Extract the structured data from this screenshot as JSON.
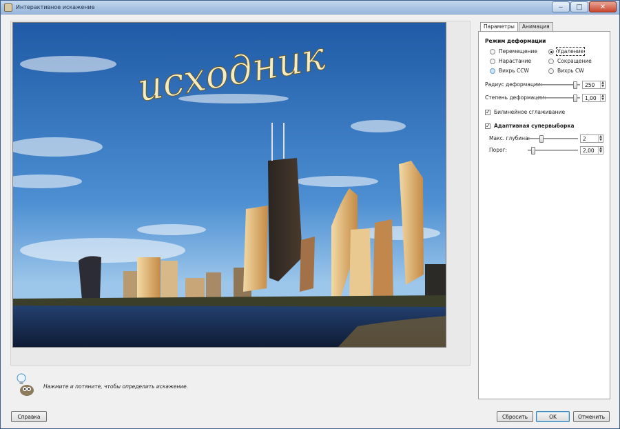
{
  "window": {
    "title": "Интерактивное искажение",
    "controls": {
      "minimize": "‒",
      "maximize": "□",
      "close": "✕"
    }
  },
  "preview": {
    "overlay_text": "исходник",
    "sky_color": "#3e74b8",
    "water_color": "#1c2f52"
  },
  "hint": {
    "text": "Нажмите и потяните, чтобы определить искажение."
  },
  "tabs": [
    {
      "label": "Параметры",
      "active": true
    },
    {
      "label": "Анимация",
      "active": false
    }
  ],
  "deform_mode": {
    "title": "Режим деформации",
    "options": {
      "move": "Перемещение",
      "remove": "Удаление",
      "grow": "Нарастание",
      "shrink": "Сокращение",
      "swirl_ccw": "Вихрь CCW",
      "swirl_cw": "Вихрь CW"
    },
    "selected": "Удаление"
  },
  "sliders": {
    "radius": {
      "label": "Радиус деформации:",
      "value": "250",
      "fraction": 0.93
    },
    "amount": {
      "label": "Степень деформации:",
      "value": "1,00",
      "fraction": 0.93
    }
  },
  "bilinear": {
    "label": "Билинейное сглаживание",
    "checked": true
  },
  "supersample": {
    "label": "Адаптивная супервыборка",
    "checked": true,
    "max_depth": {
      "label": "Макс. глубина:",
      "value": "2",
      "fraction": 0.25
    },
    "threshold": {
      "label": "Порог:",
      "value": "2,00",
      "fraction": 0.07
    }
  },
  "buttons": {
    "help": "Справка",
    "reset": "Сбросить",
    "ok": "OK",
    "cancel": "Отменить"
  }
}
